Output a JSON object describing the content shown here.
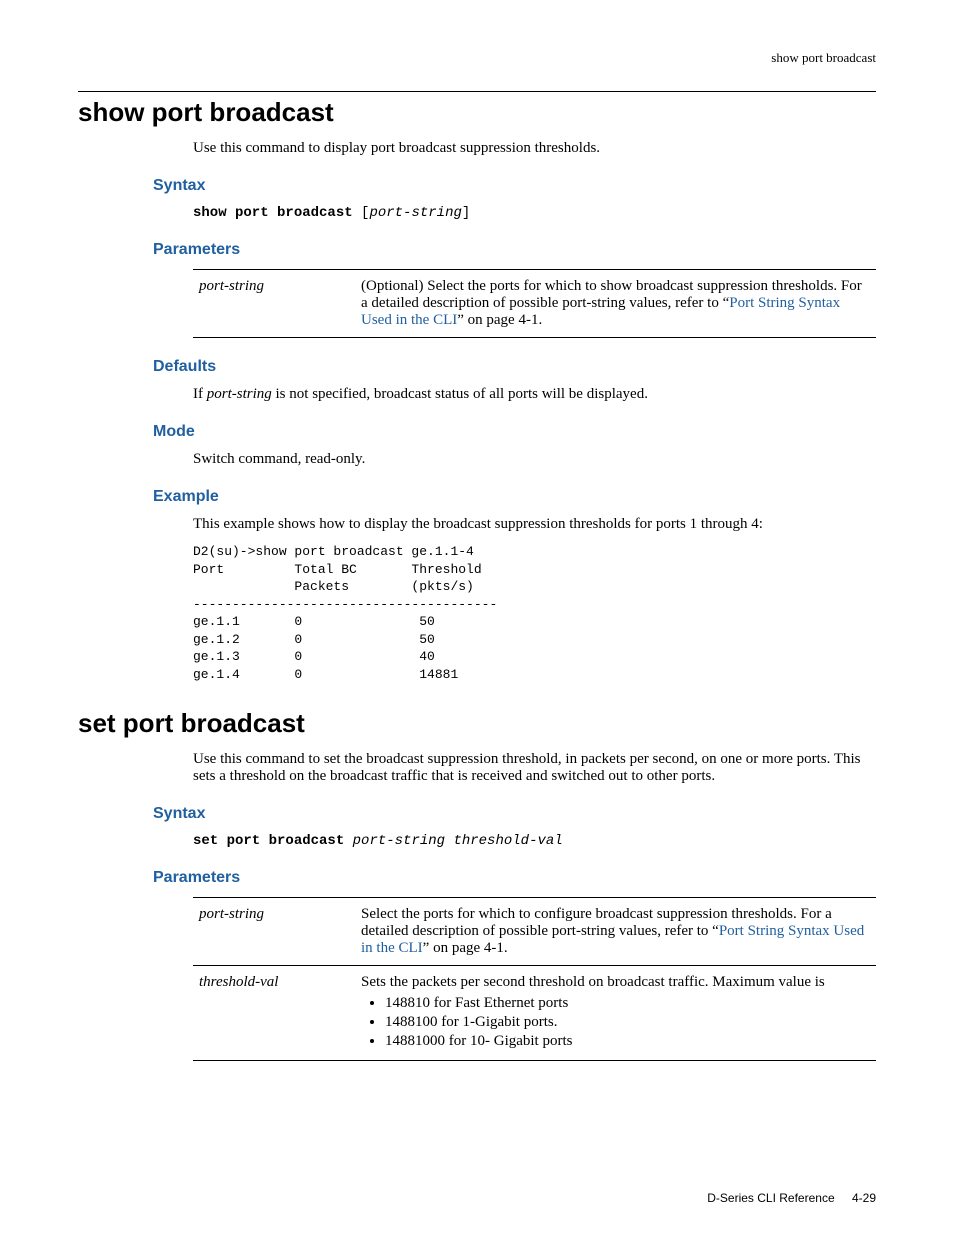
{
  "header": {
    "breadcrumb": "show port broadcast"
  },
  "section1": {
    "title": "show port broadcast",
    "intro": "Use this command to display port broadcast suppression thresholds.",
    "syntax": {
      "heading": "Syntax",
      "cmd_bold": "show port broadcast",
      "cmd_opt_open": " [",
      "cmd_arg": "port-string",
      "cmd_opt_close": "]"
    },
    "parameters": {
      "heading": "Parameters",
      "rows": [
        {
          "name": "port-string",
          "desc_pre": "(Optional) Select the ports for which to show broadcast suppression thresholds. For a detailed description of possible ",
          "desc_italic": "port-string",
          "desc_mid": " values, refer to “",
          "desc_link": "Port String Syntax Used in the CLI",
          "desc_post": "” on page 4-1."
        }
      ]
    },
    "defaults": {
      "heading": "Defaults",
      "text_pre": "If ",
      "text_italic": "port-string",
      "text_post": " is not specified, broadcast status of all ports will be displayed."
    },
    "mode": {
      "heading": "Mode",
      "text": "Switch command, read-only."
    },
    "example": {
      "heading": "Example",
      "intro": "This example shows how to display the broadcast suppression thresholds for ports 1 through 4:",
      "code": "D2(su)->show port broadcast ge.1.1-4\nPort         Total BC       Threshold\n             Packets        (pkts/s)\n---------------------------------------\nge.1.1       0               50\nge.1.2       0               50\nge.1.3       0               40\nge.1.4       0               14881"
    }
  },
  "section2": {
    "title": "set port broadcast",
    "intro": "Use this command to set the broadcast suppression threshold, in packets per second, on one or more ports. This sets a threshold on the broadcast traffic that is received and switched out to other ports.",
    "syntax": {
      "heading": "Syntax",
      "cmd_bold": "set port broadcast",
      "cmd_arg": " port-string threshold-val"
    },
    "parameters": {
      "heading": "Parameters",
      "row1": {
        "name": "port-string",
        "desc_pre": "Select the ports for which to configure broadcast suppression thresholds. For a detailed description of possible ",
        "desc_italic": "port-string",
        "desc_mid": " values, refer to “",
        "desc_link": "Port String Syntax Used in the CLI",
        "desc_post": "” on page 4-1."
      },
      "row2": {
        "name": "threshold-val",
        "desc_pre": "Sets the packets per second threshold on broadcast traffic. Maximum value is",
        "bullets": [
          "148810 for Fast Ethernet ports",
          "1488100 for 1-Gigabit ports.",
          "14881000 for 10- Gigabit ports"
        ]
      }
    }
  },
  "footer": {
    "doc": "D-Series CLI Reference",
    "pagenum": "4-29"
  }
}
